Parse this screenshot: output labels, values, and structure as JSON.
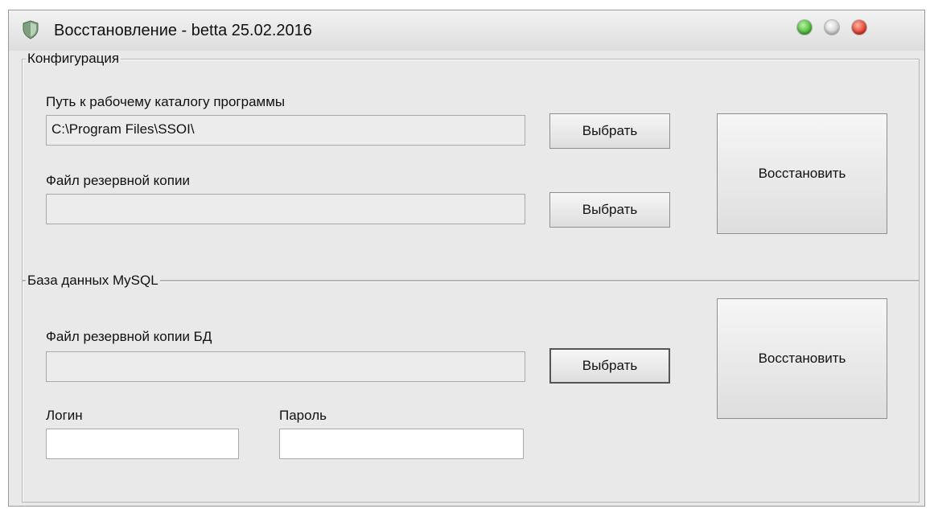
{
  "window": {
    "title": "Восстановление - betta 25.02.2016"
  },
  "config": {
    "legend": "Конфигурация",
    "program_path_label": "Путь к рабочему каталогу программы",
    "program_path_value": "C:\\Program Files\\SSOI\\",
    "browse_path_label": "Выбрать",
    "backup_file_label": "Файл резервной копии",
    "backup_file_value": "",
    "browse_backup_label": "Выбрать",
    "restore_label": "Восстановить"
  },
  "mysql": {
    "legend": "База данных MySQL",
    "db_backup_label": "Файл резервной копии БД",
    "db_backup_value": "",
    "browse_db_label": "Выбрать",
    "login_label": "Логин",
    "login_value": "",
    "password_label": "Пароль",
    "password_value": "",
    "restore_label": "Восстановить"
  }
}
